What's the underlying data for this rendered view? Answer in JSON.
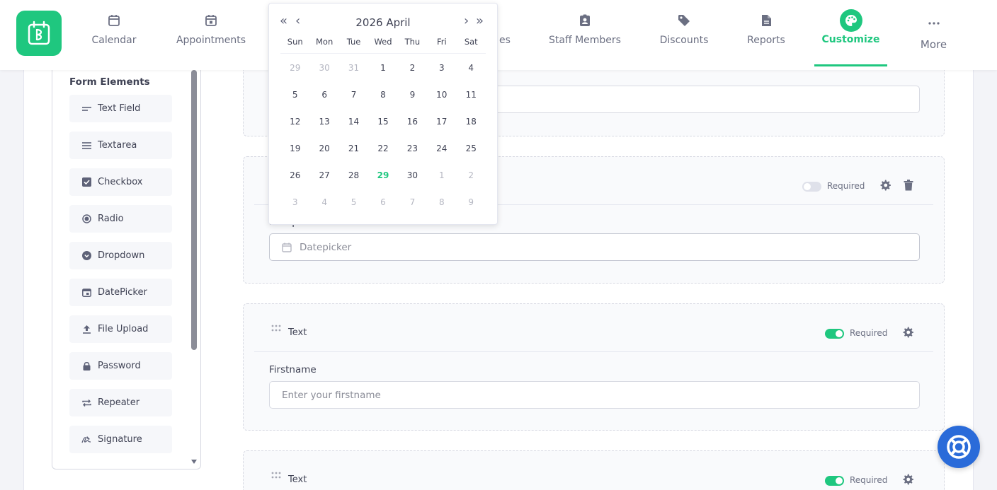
{
  "nav": {
    "items": [
      {
        "label": "Calendar",
        "icon": "calendar-icon"
      },
      {
        "label": "Appointments",
        "icon": "calendar-check-icon"
      },
      {
        "label": "es",
        "icon": ""
      },
      {
        "label": "Staff Members",
        "icon": "id-badge-icon"
      },
      {
        "label": "Discounts",
        "icon": "tag-icon"
      },
      {
        "label": "Reports",
        "icon": "document-icon"
      },
      {
        "label": "Customize",
        "icon": "palette-icon",
        "active": true
      },
      {
        "label": "More",
        "icon": "ellipsis-icon"
      }
    ]
  },
  "sidebar": {
    "title": "Form Elements",
    "items": [
      {
        "label": "Text Field",
        "icon": "text-field-icon"
      },
      {
        "label": "Textarea",
        "icon": "textarea-icon"
      },
      {
        "label": "Checkbox",
        "icon": "checkbox-icon"
      },
      {
        "label": "Radio",
        "icon": "radio-icon"
      },
      {
        "label": "Dropdown",
        "icon": "dropdown-icon"
      },
      {
        "label": "DatePicker",
        "icon": "datepicker-icon"
      },
      {
        "label": "File Upload",
        "icon": "upload-icon"
      },
      {
        "label": "Password",
        "icon": "lock-icon"
      },
      {
        "label": "Repeater",
        "icon": "repeat-icon"
      },
      {
        "label": "Signature",
        "icon": "signature-icon"
      }
    ]
  },
  "form": {
    "required_label": "Required",
    "datepicker_section": {
      "label": "Datepicker",
      "placeholder": "Datepicker",
      "required": false
    },
    "firstname_section": {
      "title": "Text",
      "label": "Firstname",
      "placeholder": "Enter your firstname",
      "required": true
    },
    "third_section": {
      "title": "Text",
      "required": true
    }
  },
  "datepicker": {
    "title": "2026 April",
    "prev_year": "«",
    "prev_month": "‹",
    "next_month": "›",
    "next_year": "»",
    "weekdays": [
      "Sun",
      "Mon",
      "Tue",
      "Wed",
      "Thu",
      "Fri",
      "Sat"
    ],
    "weeks": [
      [
        {
          "d": "29",
          "m": true
        },
        {
          "d": "30",
          "m": true
        },
        {
          "d": "31",
          "m": true
        },
        {
          "d": "1"
        },
        {
          "d": "2"
        },
        {
          "d": "3"
        },
        {
          "d": "4"
        }
      ],
      [
        {
          "d": "5"
        },
        {
          "d": "6"
        },
        {
          "d": "7"
        },
        {
          "d": "8"
        },
        {
          "d": "9"
        },
        {
          "d": "10"
        },
        {
          "d": "11"
        }
      ],
      [
        {
          "d": "12"
        },
        {
          "d": "13"
        },
        {
          "d": "14"
        },
        {
          "d": "15"
        },
        {
          "d": "16"
        },
        {
          "d": "17"
        },
        {
          "d": "18"
        }
      ],
      [
        {
          "d": "19"
        },
        {
          "d": "20"
        },
        {
          "d": "21"
        },
        {
          "d": "22"
        },
        {
          "d": "23"
        },
        {
          "d": "24"
        },
        {
          "d": "25"
        }
      ],
      [
        {
          "d": "26"
        },
        {
          "d": "27"
        },
        {
          "d": "28"
        },
        {
          "d": "29",
          "today": true
        },
        {
          "d": "30"
        },
        {
          "d": "1",
          "m": true
        },
        {
          "d": "2",
          "m": true
        }
      ],
      [
        {
          "d": "3",
          "m": true
        },
        {
          "d": "4",
          "m": true
        },
        {
          "d": "5",
          "m": true
        },
        {
          "d": "6",
          "m": true
        },
        {
          "d": "7",
          "m": true
        },
        {
          "d": "8",
          "m": true
        },
        {
          "d": "9",
          "m": true
        }
      ]
    ]
  },
  "colors": {
    "accent": "#1fc77f",
    "help_button": "#2a6bd9"
  }
}
